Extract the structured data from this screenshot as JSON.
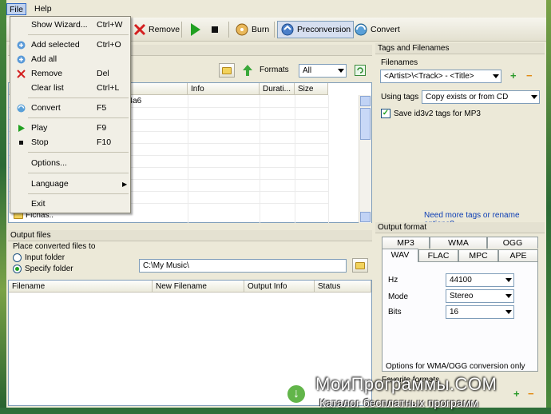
{
  "menubar": {
    "file": "File",
    "help": "Help"
  },
  "toolbar": {
    "remove": "Remove",
    "burn": "Burn",
    "preconversion": "Preconversion",
    "convert": "Convert"
  },
  "file_menu": {
    "items": [
      {
        "label": "Show Wizard...",
        "shortcut": "Ctrl+W"
      },
      {
        "label": "Add selected",
        "shortcut": "Ctrl+O"
      },
      {
        "label": "Add all",
        "shortcut": ""
      },
      {
        "label": "Remove",
        "shortcut": "Del"
      },
      {
        "label": "Clear list",
        "shortcut": "Ctrl+L"
      },
      {
        "label": "Convert",
        "shortcut": "F5"
      },
      {
        "label": "Play",
        "shortcut": "F9"
      },
      {
        "label": "Stop",
        "shortcut": "F10"
      },
      {
        "label": "Options...",
        "shortcut": ""
      },
      {
        "label": "Language",
        "shortcut": ""
      },
      {
        "label": "Exit",
        "shortcut": ""
      }
    ]
  },
  "input_files": {
    "formats_label": "Formats",
    "formats_value": "All",
    "columns": [
      "Info",
      "Durati...",
      "Size"
    ],
    "first_row_fragment": "e4a6",
    "folder_item": "Fichas.."
  },
  "output_files": {
    "title": "Output files",
    "group_label": "Place converted files to",
    "option_input": "Input folder",
    "option_specify": "Specify folder",
    "folder_path": "C:\\My Music\\",
    "columns": [
      "Filename",
      "New Filename",
      "Output Info",
      "Status"
    ]
  },
  "tags_panel": {
    "title": "Tags and Filenames",
    "filenames_label": "Filenames",
    "filename_pattern": "<Artist>\\<Track> - <Title>",
    "using_tags_label": "Using tags",
    "using_tags_value": "Copy exists or from CD",
    "save_id3_label": "Save id3v2 tags for MP3",
    "save_id3_checked": true,
    "more_tags_link": "Need more tags or rename options?"
  },
  "output_format": {
    "title": "Output format",
    "tabs_row1": [
      "MP3",
      "WMA",
      "OGG"
    ],
    "tabs_row2": [
      "WAV",
      "FLAC",
      "MPC",
      "APE"
    ],
    "active_tab": "WAV",
    "hz_label": "Hz",
    "hz_value": "44100",
    "mode_label": "Mode",
    "mode_value": "Stereo",
    "bits_label": "Bits",
    "bits_value": "16",
    "note": "Options for WMA/OGG conversion only",
    "favorite_formats": "Favorite formats"
  },
  "watermark": {
    "title": "МоиПрограммы.COM",
    "subtitle": "Каталог бесплатных программ"
  },
  "colors": {
    "window_bg": "#ece9d8",
    "selection": "#c1d2ee",
    "link": "#0a3cb4",
    "plus_green": "#2a9a2a",
    "minus_orange": "#e18a12"
  }
}
